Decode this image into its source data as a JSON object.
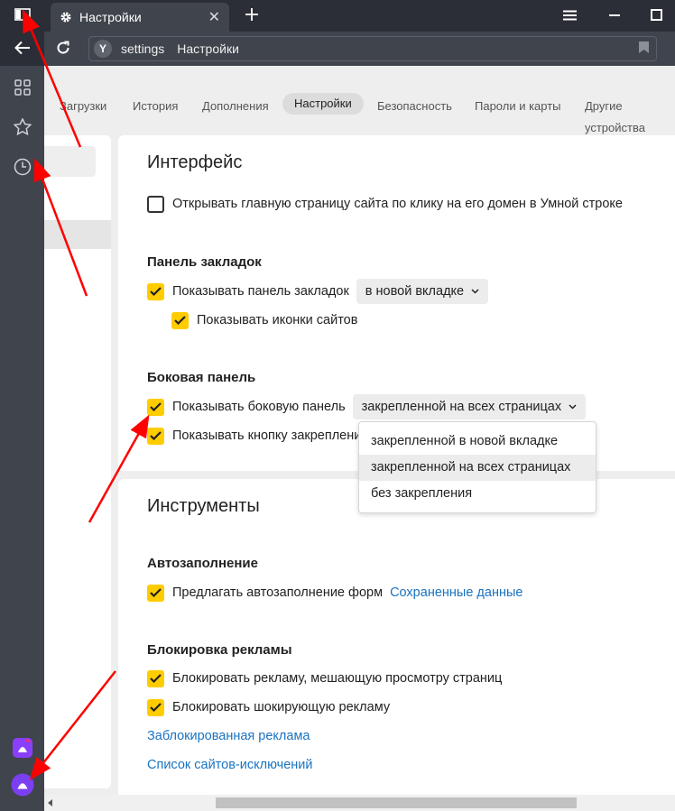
{
  "window": {
    "tab_title": "Настройки",
    "close_glyph": "✕"
  },
  "omnibox": {
    "host": "settings",
    "page_title": "Настройки"
  },
  "settings_nav": {
    "tabs": [
      "Загрузки",
      "История",
      "Дополнения",
      "Настройки",
      "Безопасность",
      "Пароли и карты",
      "Другие устройства"
    ],
    "active_tab": "Настройки"
  },
  "interface": {
    "title": "Интерфейс",
    "open_homepage_checkbox": "Открывать главную страницу сайта по клику на его домен в Умной строке",
    "bookmarks": {
      "heading": "Панель закладок",
      "show_panel": "Показывать панель закладок",
      "show_panel_select": "в новой вкладке",
      "show_icons": "Показывать иконки сайтов"
    },
    "sidebar": {
      "heading": "Боковая панель",
      "show_sidebar": "Показывать боковую панель",
      "show_sidebar_select": "закрепленной на всех страницах",
      "show_pin_button": "Показывать кнопку закреплени"
    }
  },
  "dropdown": {
    "options": [
      "закрепленной в новой вкладке",
      "закрепленной на всех страницах",
      "без закрепления"
    ],
    "selected_index": 1
  },
  "tools": {
    "title": "Инструменты",
    "autofill": {
      "heading": "Автозаполнение",
      "offer_autofill": "Предлагать автозаполнение форм",
      "saved_data_link": "Сохраненные данные"
    },
    "adblock": {
      "heading": "Блокировка рекламы",
      "block_annoying": "Блокировать рекламу, мешающую просмотру страниц",
      "block_shocking": "Блокировать шокирующую рекламу",
      "blocked_ads_link": "Заблокированная реклама",
      "exceptions_link": "Список сайтов-исключений"
    }
  },
  "checkbox_states": {
    "open_homepage": false,
    "show_bookmarks_panel": true,
    "show_site_icons": true,
    "show_sidebar": true,
    "show_pin_button": true,
    "offer_autofill": true,
    "block_annoying": true,
    "block_shocking": true
  },
  "icons": {
    "sidebar_toggle": "sidebar-toggle-icon",
    "gear": "gear-icon",
    "new_tab": "plus-icon",
    "menu": "hamburger-menu-icon",
    "minimize": "minimize-icon",
    "maximize": "maximize-icon",
    "back": "back-arrow-icon",
    "reload": "reload-icon",
    "yandex_logo": "Y",
    "bookmark": "bookmark-icon",
    "apps": "apps-grid-icon",
    "favorites": "star-icon",
    "history": "clock-icon",
    "alice": "alice-icon"
  },
  "colors": {
    "accent_checkbox": "#ffcc00",
    "link": "#1a73c0",
    "chrome_dark": "#2b2e36",
    "chrome_mid": "#40444d",
    "annotation_arrow": "#ff0000"
  }
}
